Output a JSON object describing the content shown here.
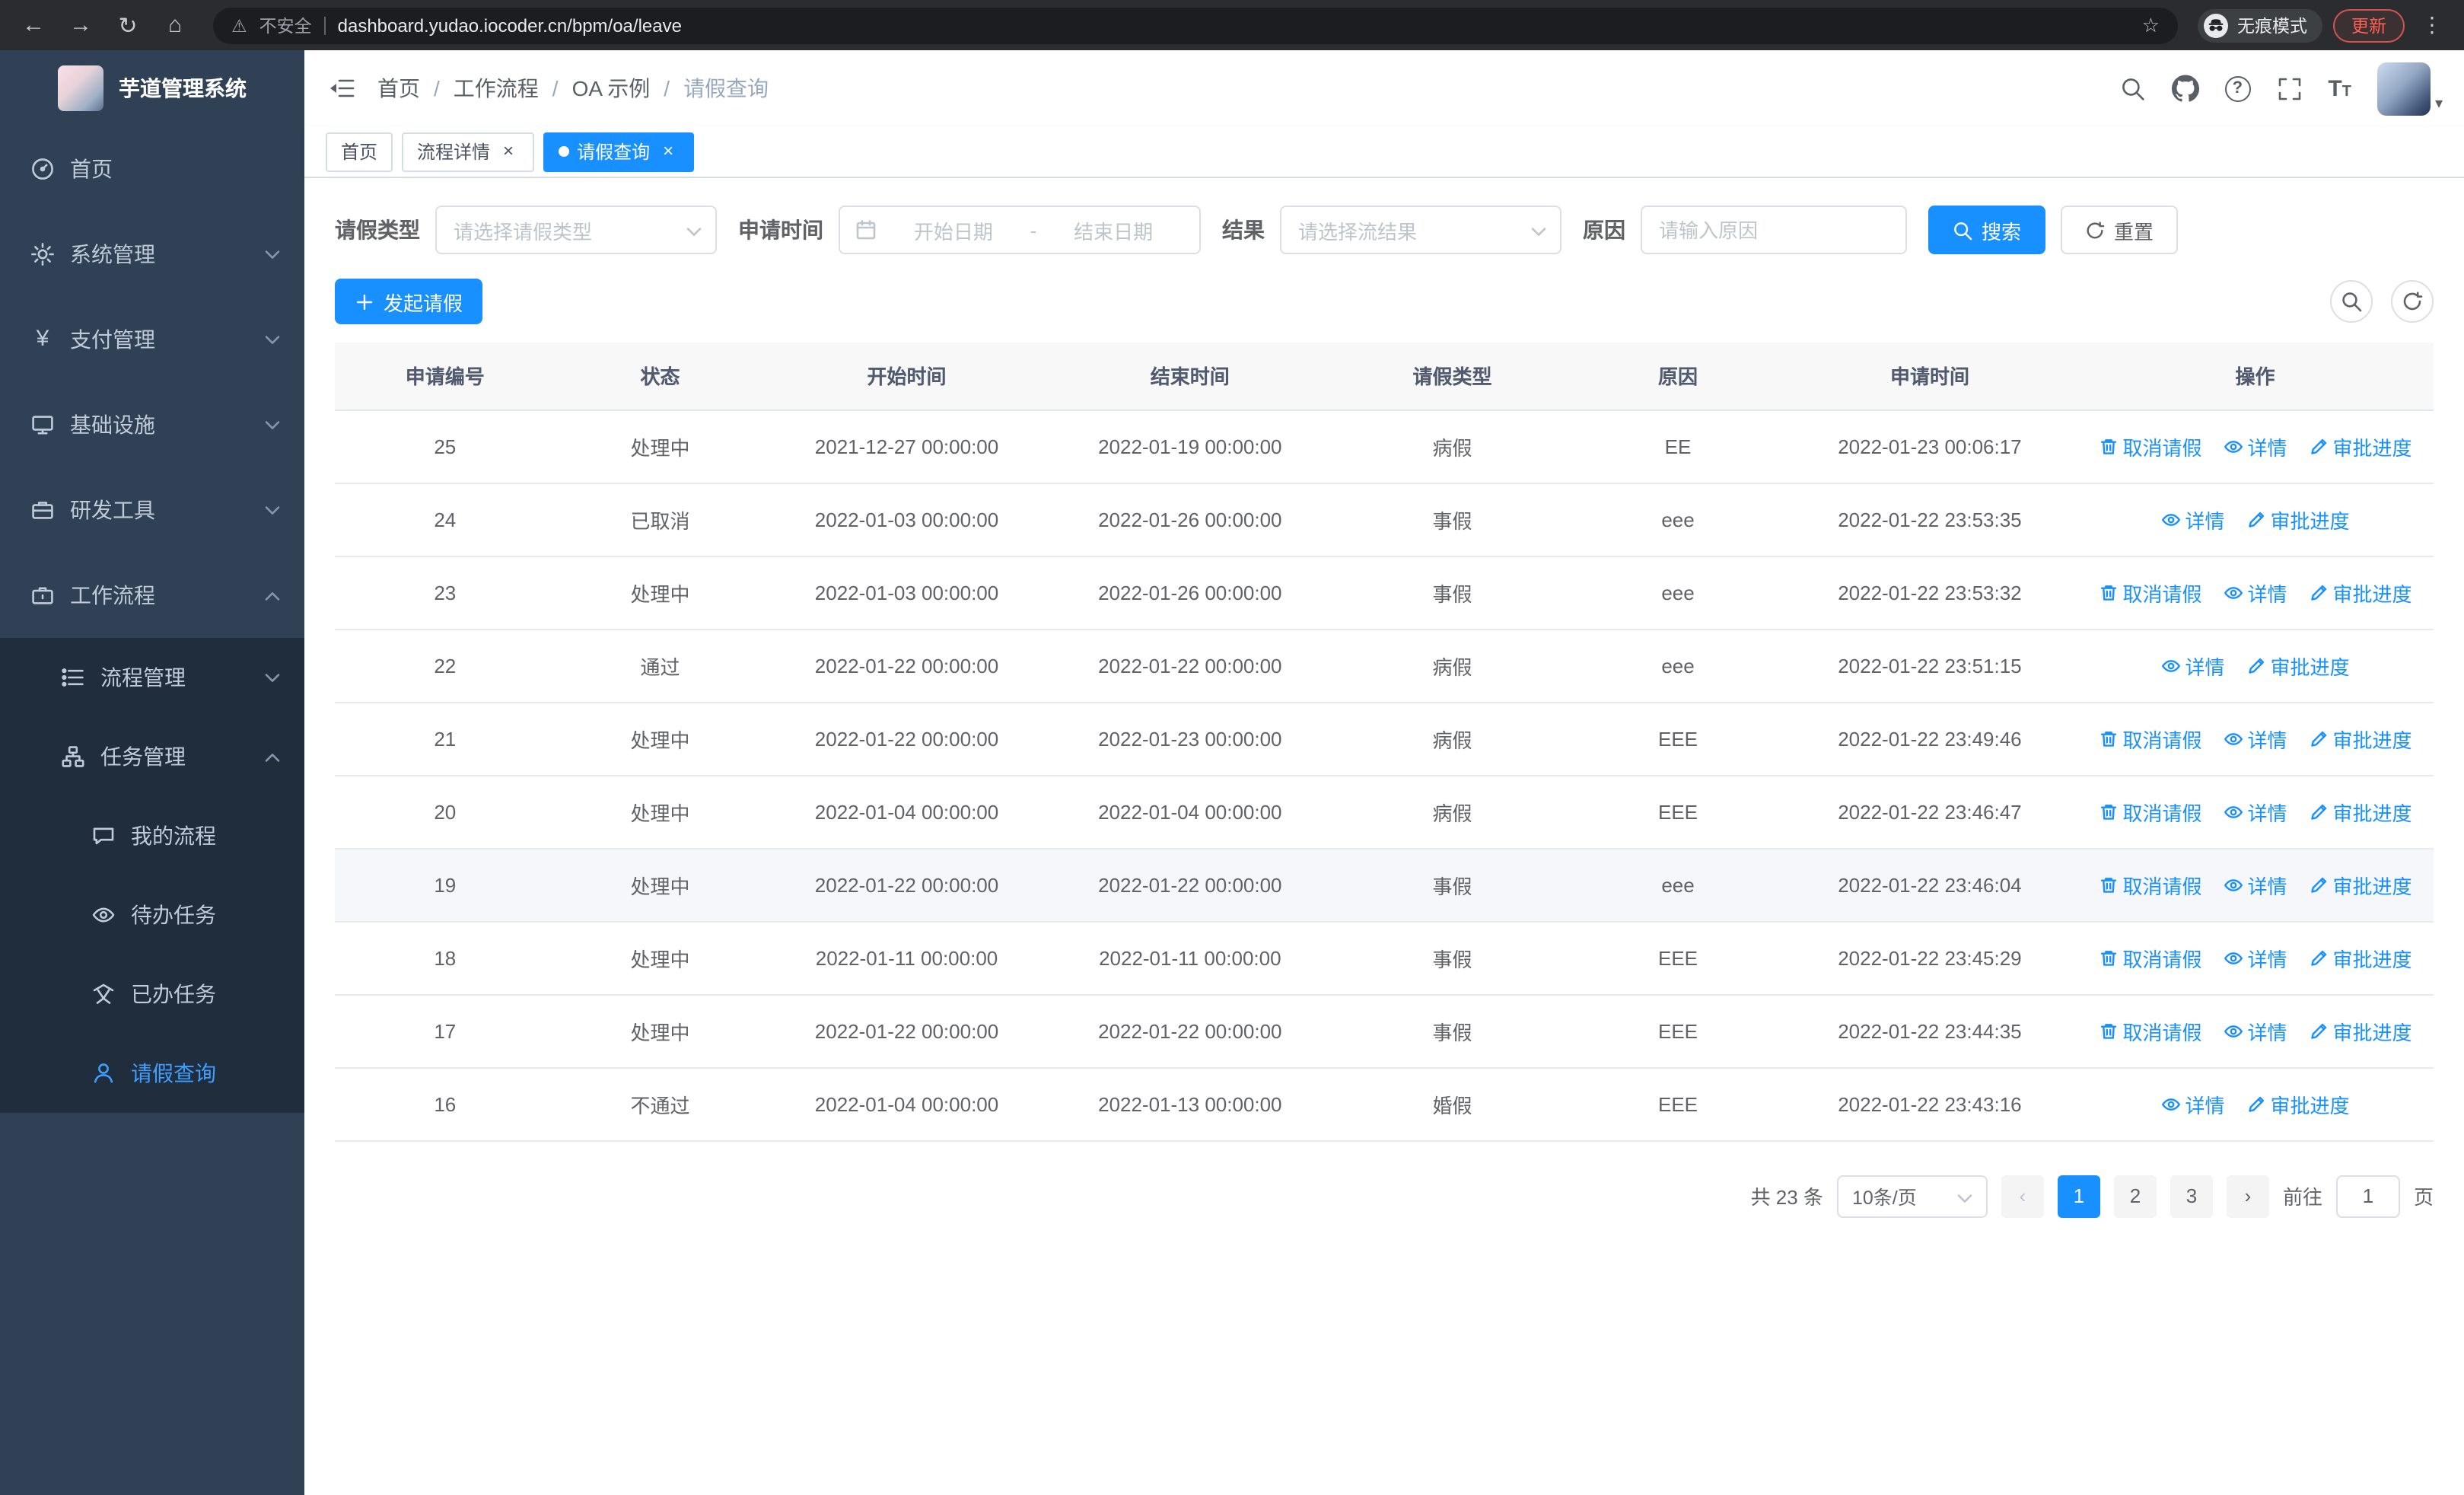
{
  "colors": {
    "primary": "#1890ff",
    "sidebar_bg": "#304156",
    "sidebar_submenu_bg": "#1f2d3d",
    "sidebar_active": "#409eff",
    "update_badge": "#ff6257"
  },
  "browser": {
    "security_warning": "不安全",
    "url": "dashboard.yudao.iocoder.cn/bpm/oa/leave",
    "incognito_label": "无痕模式",
    "update_label": "更新"
  },
  "icons": {
    "back": "←",
    "forward": "→",
    "reload": "↻",
    "home": "⌂",
    "warning": "⚠",
    "star": "☆",
    "menu_dots": "⋮",
    "close": "×",
    "caret_down": "▾",
    "prev": "‹",
    "next": "›",
    "yen": "¥",
    "question": "?",
    "font_large": "T",
    "font_small": "T"
  },
  "sidebar": {
    "logo_title": "芋道管理系统",
    "items": [
      {
        "label": "首页"
      },
      {
        "label": "系统管理"
      },
      {
        "label": "支付管理"
      },
      {
        "label": "基础设施"
      },
      {
        "label": "研发工具"
      },
      {
        "label": "工作流程"
      }
    ],
    "submenu": [
      {
        "label": "流程管理"
      },
      {
        "label": "任务管理"
      }
    ],
    "task_children": [
      {
        "label": "我的流程"
      },
      {
        "label": "待办任务"
      },
      {
        "label": "已办任务"
      },
      {
        "label": "请假查询"
      }
    ]
  },
  "header": {
    "breadcrumb": [
      "首页",
      "工作流程",
      "OA 示例",
      "请假查询"
    ],
    "separator": "/"
  },
  "tabs": [
    {
      "label": "首页"
    },
    {
      "label": "流程详情"
    },
    {
      "label": "请假查询"
    }
  ],
  "filters": {
    "leave_type_label": "请假类型",
    "leave_type_placeholder": "请选择请假类型",
    "apply_time_label": "申请时间",
    "start_date_placeholder": "开始日期",
    "range_separator": "-",
    "end_date_placeholder": "结束日期",
    "result_label": "结果",
    "result_placeholder": "请选择流结果",
    "reason_label": "原因",
    "reason_placeholder": "请输入原因",
    "search_button": "搜索",
    "reset_button": "重置"
  },
  "toolbar": {
    "create_button": "发起请假"
  },
  "table": {
    "columns": [
      "申请编号",
      "状态",
      "开始时间",
      "结束时间",
      "请假类型",
      "原因",
      "申请时间",
      "操作"
    ],
    "action_labels": {
      "cancel": "取消请假",
      "detail": "详情",
      "progress": "审批进度"
    },
    "rows": [
      {
        "id": "25",
        "status": "处理中",
        "start": "2021-12-27 00:00:00",
        "end": "2022-01-19 00:00:00",
        "type": "病假",
        "reason": "EE",
        "applied": "2022-01-23 00:06:17",
        "actions": [
          "cancel",
          "detail",
          "progress"
        ]
      },
      {
        "id": "24",
        "status": "已取消",
        "start": "2022-01-03 00:00:00",
        "end": "2022-01-26 00:00:00",
        "type": "事假",
        "reason": "eee",
        "applied": "2022-01-22 23:53:35",
        "actions": [
          "detail",
          "progress"
        ]
      },
      {
        "id": "23",
        "status": "处理中",
        "start": "2022-01-03 00:00:00",
        "end": "2022-01-26 00:00:00",
        "type": "事假",
        "reason": "eee",
        "applied": "2022-01-22 23:53:32",
        "actions": [
          "cancel",
          "detail",
          "progress"
        ]
      },
      {
        "id": "22",
        "status": "通过",
        "start": "2022-01-22 00:00:00",
        "end": "2022-01-22 00:00:00",
        "type": "病假",
        "reason": "eee",
        "applied": "2022-01-22 23:51:15",
        "actions": [
          "detail",
          "progress"
        ]
      },
      {
        "id": "21",
        "status": "处理中",
        "start": "2022-01-22 00:00:00",
        "end": "2022-01-23 00:00:00",
        "type": "病假",
        "reason": "EEE",
        "applied": "2022-01-22 23:49:46",
        "actions": [
          "cancel",
          "detail",
          "progress"
        ]
      },
      {
        "id": "20",
        "status": "处理中",
        "start": "2022-01-04 00:00:00",
        "end": "2022-01-04 00:00:00",
        "type": "病假",
        "reason": "EEE",
        "applied": "2022-01-22 23:46:47",
        "actions": [
          "cancel",
          "detail",
          "progress"
        ]
      },
      {
        "id": "19",
        "status": "处理中",
        "start": "2022-01-22 00:00:00",
        "end": "2022-01-22 00:00:00",
        "type": "事假",
        "reason": "eee",
        "applied": "2022-01-22 23:46:04",
        "actions": [
          "cancel",
          "detail",
          "progress"
        ],
        "highlighted": true
      },
      {
        "id": "18",
        "status": "处理中",
        "start": "2022-01-11 00:00:00",
        "end": "2022-01-11 00:00:00",
        "type": "事假",
        "reason": "EEE",
        "applied": "2022-01-22 23:45:29",
        "actions": [
          "cancel",
          "detail",
          "progress"
        ]
      },
      {
        "id": "17",
        "status": "处理中",
        "start": "2022-01-22 00:00:00",
        "end": "2022-01-22 00:00:00",
        "type": "事假",
        "reason": "EEE",
        "applied": "2022-01-22 23:44:35",
        "actions": [
          "cancel",
          "detail",
          "progress"
        ]
      },
      {
        "id": "16",
        "status": "不通过",
        "start": "2022-01-04 00:00:00",
        "end": "2022-01-13 00:00:00",
        "type": "婚假",
        "reason": "EEE",
        "applied": "2022-01-22 23:43:16",
        "actions": [
          "detail",
          "progress"
        ]
      }
    ]
  },
  "pagination": {
    "total": "共 23 条",
    "page_size": "10条/页",
    "pages": [
      "1",
      "2",
      "3"
    ],
    "active_page": "1",
    "goto_label": "前往",
    "goto_value": "1",
    "page_unit": "页"
  }
}
